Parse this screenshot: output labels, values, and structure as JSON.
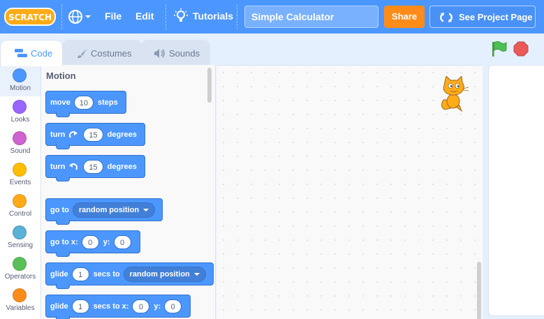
{
  "menubar": {
    "logo_text": "SCRATCH",
    "file_label": "File",
    "edit_label": "Edit",
    "tutorials_label": "Tutorials",
    "project_title": "Simple Calculator",
    "share_label": "Share",
    "see_project_label": "See Project Page",
    "bar_color": "#4c97ff",
    "share_color": "#ff8c1a"
  },
  "tabs": [
    {
      "label": "Code",
      "active": true,
      "icon": "code-icon"
    },
    {
      "label": "Costumes",
      "active": false,
      "icon": "paintbrush-icon"
    },
    {
      "label": "Sounds",
      "active": false,
      "icon": "speaker-icon"
    }
  ],
  "controls": {
    "start": "green-flag-icon",
    "stop": "stop-sign-icon"
  },
  "categories": [
    {
      "label": "Motion",
      "color": "#4c97ff",
      "selected": true
    },
    {
      "label": "Looks",
      "color": "#9966ff"
    },
    {
      "label": "Sound",
      "color": "#cf63cf"
    },
    {
      "label": "Events",
      "color": "#ffbf00"
    },
    {
      "label": "Control",
      "color": "#ffab19"
    },
    {
      "label": "Sensing",
      "color": "#5cb1d6"
    },
    {
      "label": "Operators",
      "color": "#59c059"
    },
    {
      "label": "Variables",
      "color": "#ff8c1a"
    }
  ],
  "palette": {
    "section_title": "Motion",
    "blocks": {
      "move": {
        "w1": "move",
        "v1": "10",
        "w2": "steps"
      },
      "turn_right": {
        "w1": "turn",
        "v1": "15",
        "w2": "degrees"
      },
      "turn_left": {
        "w1": "turn",
        "v1": "15",
        "w2": "degrees"
      },
      "goto": {
        "w1": "go to",
        "d1": "random position"
      },
      "goto_xy": {
        "w1": "go to x:",
        "v1": "0",
        "w2": "y:",
        "v2": "0"
      },
      "glide_to": {
        "w1": "glide",
        "v1": "1",
        "w2": "secs to",
        "d1": "random position"
      },
      "glide_xy": {
        "w1": "glide",
        "v1": "1",
        "w2": "secs to x:",
        "v2": "0",
        "w3": "y:",
        "v3": "0"
      }
    }
  }
}
